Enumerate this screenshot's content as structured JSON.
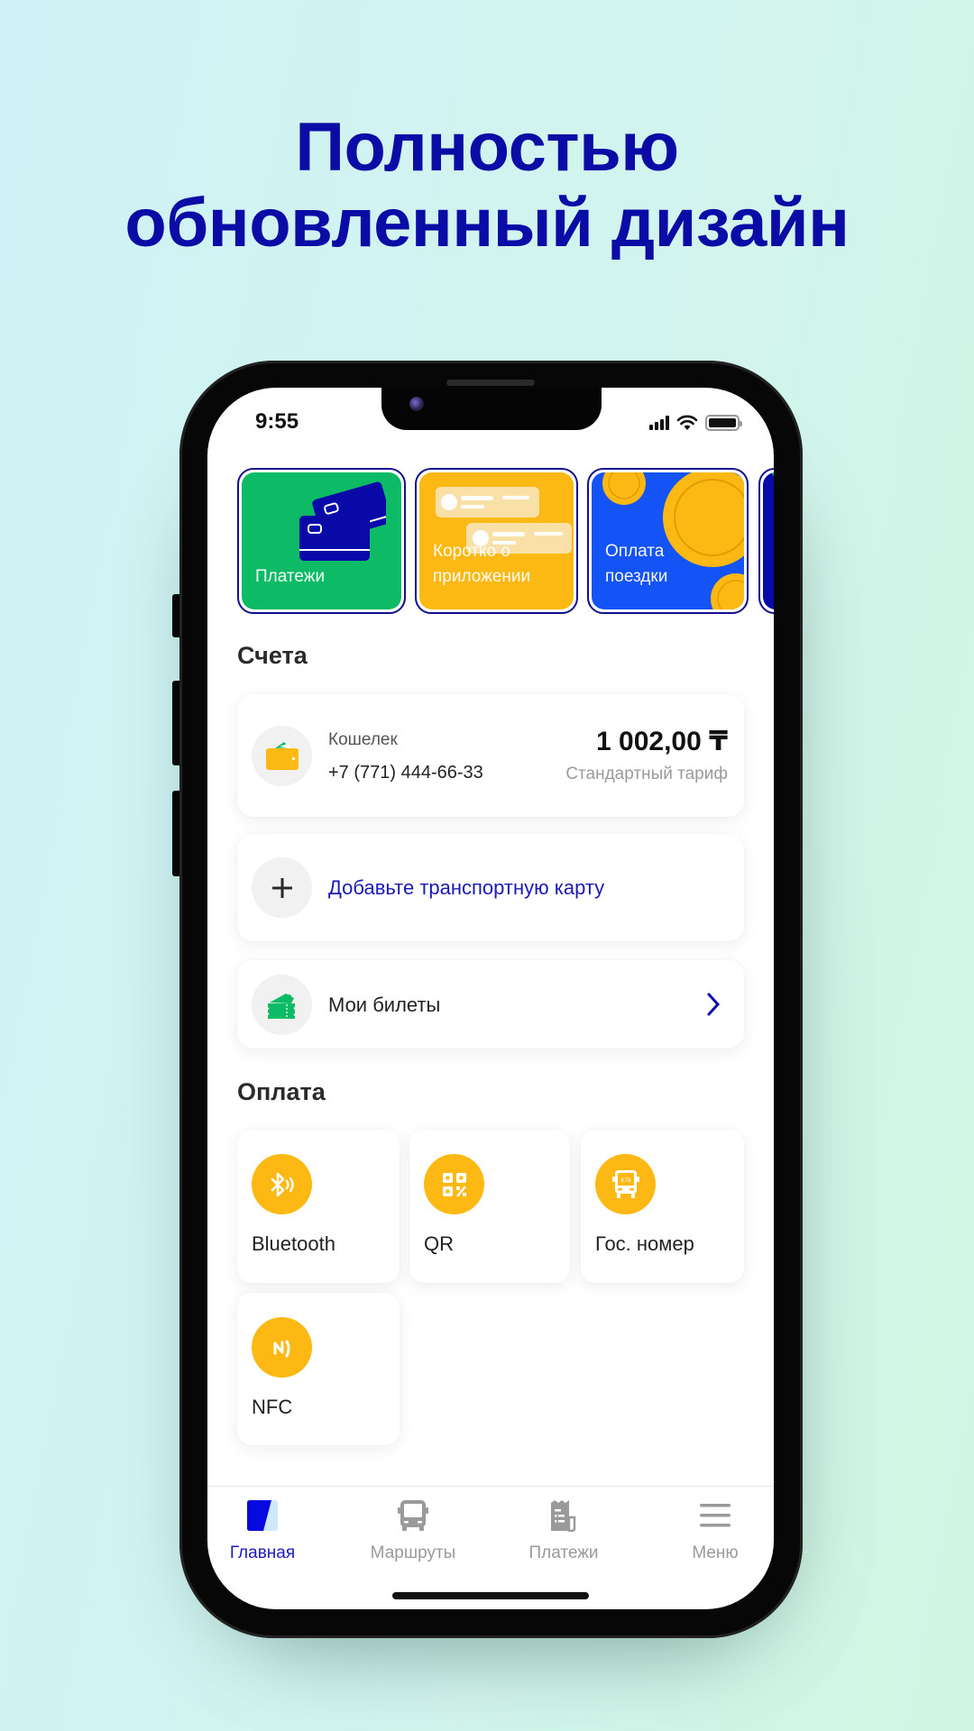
{
  "promo": {
    "title_line1": "Полностью",
    "title_line2": "обновленный дизайн",
    "title_color": "#0b0ba6"
  },
  "status_bar": {
    "time": "9:55",
    "icons": [
      "cellular-signal-icon",
      "wifi-icon",
      "battery-icon"
    ]
  },
  "stories": [
    {
      "label": "Платежи",
      "bg": "#0dbb67",
      "icon": "credit-cards-icon"
    },
    {
      "label": "Коротко о приложении",
      "bg": "#fdb913",
      "icon": "chat-bubbles-icon"
    },
    {
      "label": "Оплата поездки",
      "bg": "#1453f5",
      "icon": "coins-icon"
    },
    {
      "label": "",
      "bg": "#0a0aa8",
      "icon": "story-partial"
    }
  ],
  "accounts": {
    "title": "Счета",
    "wallet": {
      "name": "Кошелек",
      "phone": "+7 (771) 444-66-33",
      "balance": "1 002,00 ₸",
      "tariff": "Стандартный тариф",
      "icon": "wallet-icon"
    },
    "add_card": {
      "label": "Добавьте транспортную карту",
      "icon": "plus-icon"
    },
    "tickets": {
      "label": "Мои билеты",
      "icon": "ticket-icon",
      "chevron": "chevron-right-icon"
    }
  },
  "payment": {
    "title": "Оплата",
    "methods": [
      {
        "label": "Bluetooth",
        "icon": "bluetooth-icon"
      },
      {
        "label": "QR",
        "icon": "qr-code-icon"
      },
      {
        "label": "Гос. номер",
        "icon": "bus-plate-icon",
        "plate": "678"
      },
      {
        "label": "NFC",
        "icon": "nfc-icon"
      }
    ]
  },
  "bottom_nav": {
    "items": [
      {
        "label": "Главная",
        "icon": "home-icon",
        "active": true
      },
      {
        "label": "Маршруты",
        "icon": "bus-icon",
        "active": false
      },
      {
        "label": "Платежи",
        "icon": "receipt-icon",
        "active": false
      },
      {
        "label": "Меню",
        "icon": "menu-icon",
        "active": false
      }
    ],
    "active_color": "#1a1ac0",
    "inactive_color": "#9a9a9a"
  },
  "colors": {
    "accent_blue": "#0a0aa8",
    "accent_yellow": "#fdb813",
    "accent_green": "#0dbb67"
  }
}
